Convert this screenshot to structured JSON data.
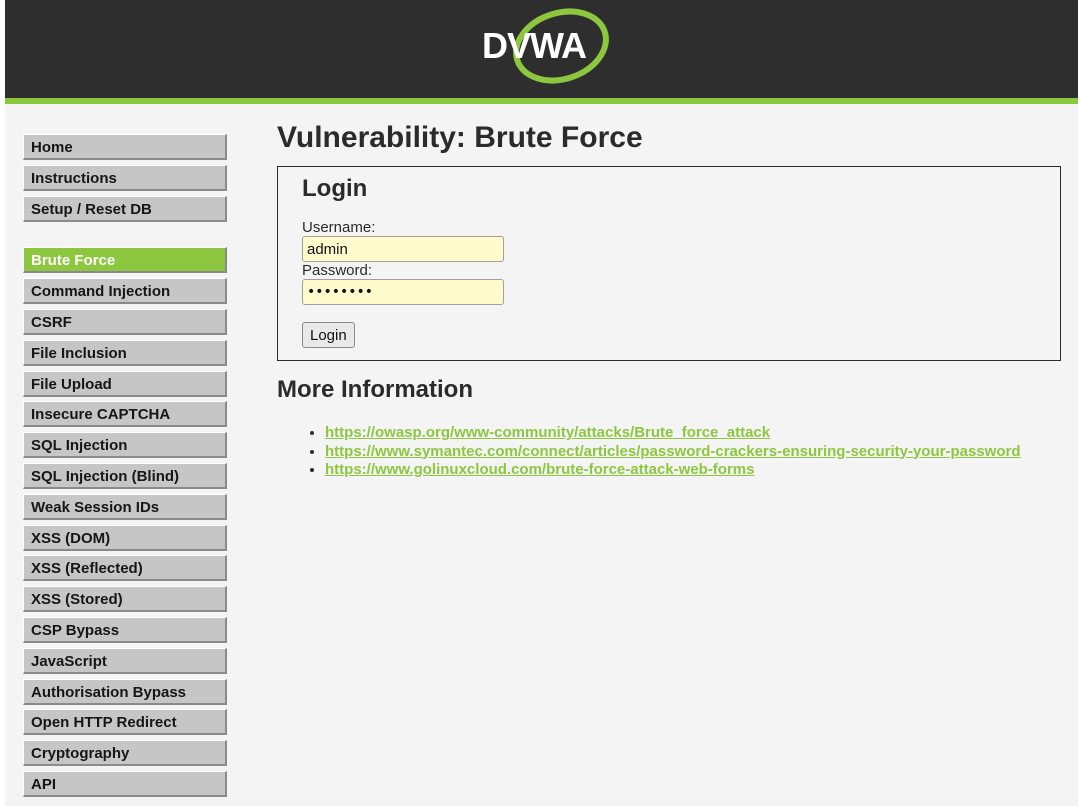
{
  "header": {
    "logo_text": "DVWA",
    "accent_color": "#8dc63f",
    "background_color": "#2e2e2e"
  },
  "sidebar": {
    "groups": [
      {
        "items": [
          {
            "label": "Home"
          },
          {
            "label": "Instructions"
          },
          {
            "label": "Setup / Reset DB"
          }
        ]
      },
      {
        "items": [
          {
            "label": "Brute Force",
            "selected": true
          },
          {
            "label": "Command Injection"
          },
          {
            "label": "CSRF"
          },
          {
            "label": "File Inclusion"
          },
          {
            "label": "File Upload"
          },
          {
            "label": "Insecure CAPTCHA"
          },
          {
            "label": "SQL Injection"
          },
          {
            "label": "SQL Injection (Blind)"
          },
          {
            "label": "Weak Session IDs"
          },
          {
            "label": "XSS (DOM)"
          },
          {
            "label": "XSS (Reflected)"
          },
          {
            "label": "XSS (Stored)"
          },
          {
            "label": "CSP Bypass"
          },
          {
            "label": "JavaScript"
          },
          {
            "label": "Authorisation Bypass"
          },
          {
            "label": "Open HTTP Redirect"
          },
          {
            "label": "Cryptography"
          },
          {
            "label": "API"
          }
        ]
      }
    ]
  },
  "main": {
    "title": "Vulnerability: Brute Force",
    "login": {
      "heading": "Login",
      "username_label": "Username:",
      "username_value": "admin",
      "password_label": "Password:",
      "password_value": "password",
      "button_label": "Login"
    },
    "more_info": {
      "heading": "More Information",
      "links": [
        "https://owasp.org/www-community/attacks/Brute_force_attack",
        "https://www.symantec.com/connect/articles/password-crackers-ensuring-security-your-password",
        "https://www.golinuxcloud.com/brute-force-attack-web-forms"
      ]
    }
  }
}
